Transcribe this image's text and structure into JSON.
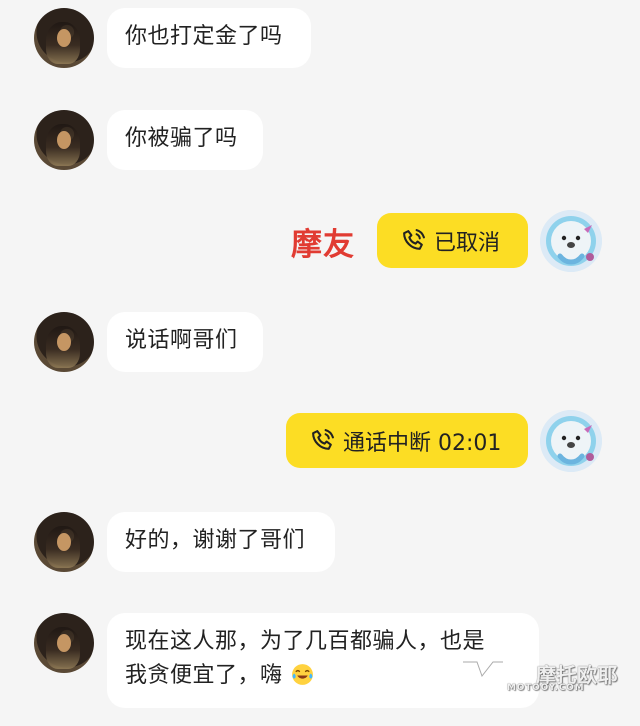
{
  "messages": [
    {
      "text": "你也打定金了吗"
    },
    {
      "text": "你被骗了吗"
    },
    {
      "text": "说话啊哥们"
    },
    {
      "text": "好的，谢谢了哥们"
    },
    {
      "text_line1": "现在这人那，为了几百都骗人，也是",
      "text_line2": "我贪便宜了，嗨"
    }
  ],
  "annotation": {
    "text": "摩友",
    "color": "#e13b32"
  },
  "calls": [
    {
      "label": "已取消"
    },
    {
      "label": "通话中断 02:01"
    }
  ],
  "watermark": {
    "brand": "摩托欧耶",
    "url": "MOTOOY.COM"
  },
  "colors": {
    "background": "#f5f5f5",
    "incoming_bubble": "#ffffff",
    "call_bubble": "#fcdd24"
  },
  "icons": {
    "call": "phone-icon",
    "emoji": "crying-laughing-emoji-icon"
  }
}
